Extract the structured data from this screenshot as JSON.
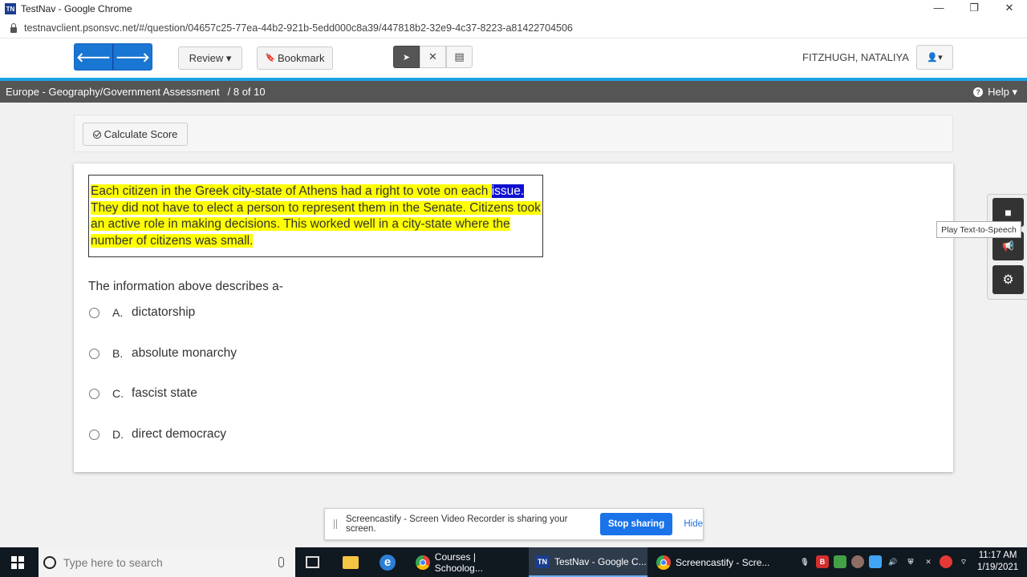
{
  "window": {
    "title": "TestNav - Google Chrome",
    "logo_text": "TN",
    "minimize": "—",
    "restore": "❐",
    "close": "✕"
  },
  "address": {
    "url": "testnavclient.psonsvc.net/#/question/04657c25-77ea-44b2-921b-5edd000c8a39/447818b2-32e9-4c37-8223-a81422704506"
  },
  "toolbar": {
    "back_icon": "🡐",
    "forward_icon": "🡒",
    "review_label": "Review ▾",
    "bookmark_label": "Bookmark",
    "bookmark_icon": "🔖",
    "pointer_icon": "➤",
    "eliminator_icon": "✕",
    "notepad_icon": "▤",
    "user_name": "FITZHUGH, NATALIYA",
    "user_menu_icon": "👤▾"
  },
  "assessment": {
    "title": "Europe - Geography/Government Assessment",
    "count": "/  8 of 10",
    "help_label": "Help ▾",
    "help_icon": "?"
  },
  "score": {
    "calculate_label": "Calculate Score"
  },
  "passage": {
    "part1": "Each citizen in the Greek city-state of Athens had a right to vote on each ",
    "selected": "issue.  ",
    "part2": "They did not have to elect a person to represent them in the Senate. Citizens took an active role in making decisions.  This worked well in a city-state where the number of citizens was small."
  },
  "question": {
    "stem": "The information above describes a-",
    "options": [
      {
        "letter": "A.",
        "text": "dictatorship"
      },
      {
        "letter": "B.",
        "text": "absolute monarchy"
      },
      {
        "letter": "C.",
        "text": "fascist state"
      },
      {
        "letter": "D.",
        "text": "direct democracy"
      }
    ]
  },
  "side_tools": {
    "tts_icon": "■",
    "announce_icon": "📢",
    "settings_icon": "⚙",
    "tooltip": "Play Text-to-Speech"
  },
  "screencastify": {
    "message": "Screencastify - Screen Video Recorder is sharing your screen.",
    "stop_label": "Stop sharing",
    "hide_label": "Hide"
  },
  "taskbar": {
    "search_placeholder": "Type here to search",
    "apps": [
      {
        "label": "Courses | Schoolog..."
      },
      {
        "label": "TestNav - Google C..."
      },
      {
        "label": "Screencastify - Scre..."
      }
    ],
    "tn_icon_text": "TN",
    "time": "11:17 AM",
    "date": "1/19/2021"
  },
  "colors": {
    "primary_blue": "#1976d2",
    "highlight": "#ffff00",
    "header_bar": "#555555",
    "accent_line": "#1ba1e2"
  }
}
